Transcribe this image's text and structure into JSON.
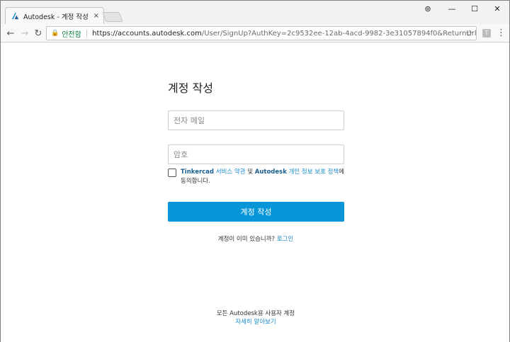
{
  "browser": {
    "tab_title": "Autodesk - 계정 작성",
    "tab_close": "×",
    "window_controls": {
      "media": "⊚",
      "minimize": "—",
      "maximize": "☐",
      "close": "✕"
    },
    "secure_label": "안전함",
    "url_host": "https://accounts.autodesk.com",
    "url_rest": "/User/SignUp?AuthKey=2c9532ee-12ab-4acd-9982-3e31057894f0&ReturnUrl=%2Faut...",
    "extension_label": "T"
  },
  "form": {
    "heading": "계정 작성",
    "email_placeholder": "전자 메일",
    "password_placeholder": "암호",
    "agree": {
      "brand1": "Tinkercad",
      "terms_link": "서비스 약관",
      "and": "및",
      "brand2": "Autodesk",
      "privacy_link": "개인 정보 보호 정책",
      "suffix": "에 동의합니다."
    },
    "submit_label": "계정 작성",
    "login_prompt": "계정이 이미 있습니까?",
    "login_link": "로그인"
  },
  "footer": {
    "line1": "모든 Autodesk용 사용자 계정",
    "learn_more": "자세히 알아보기"
  },
  "colors": {
    "primary": "#0696d7",
    "link": "#1a8ccf",
    "secure": "#0b8043"
  }
}
